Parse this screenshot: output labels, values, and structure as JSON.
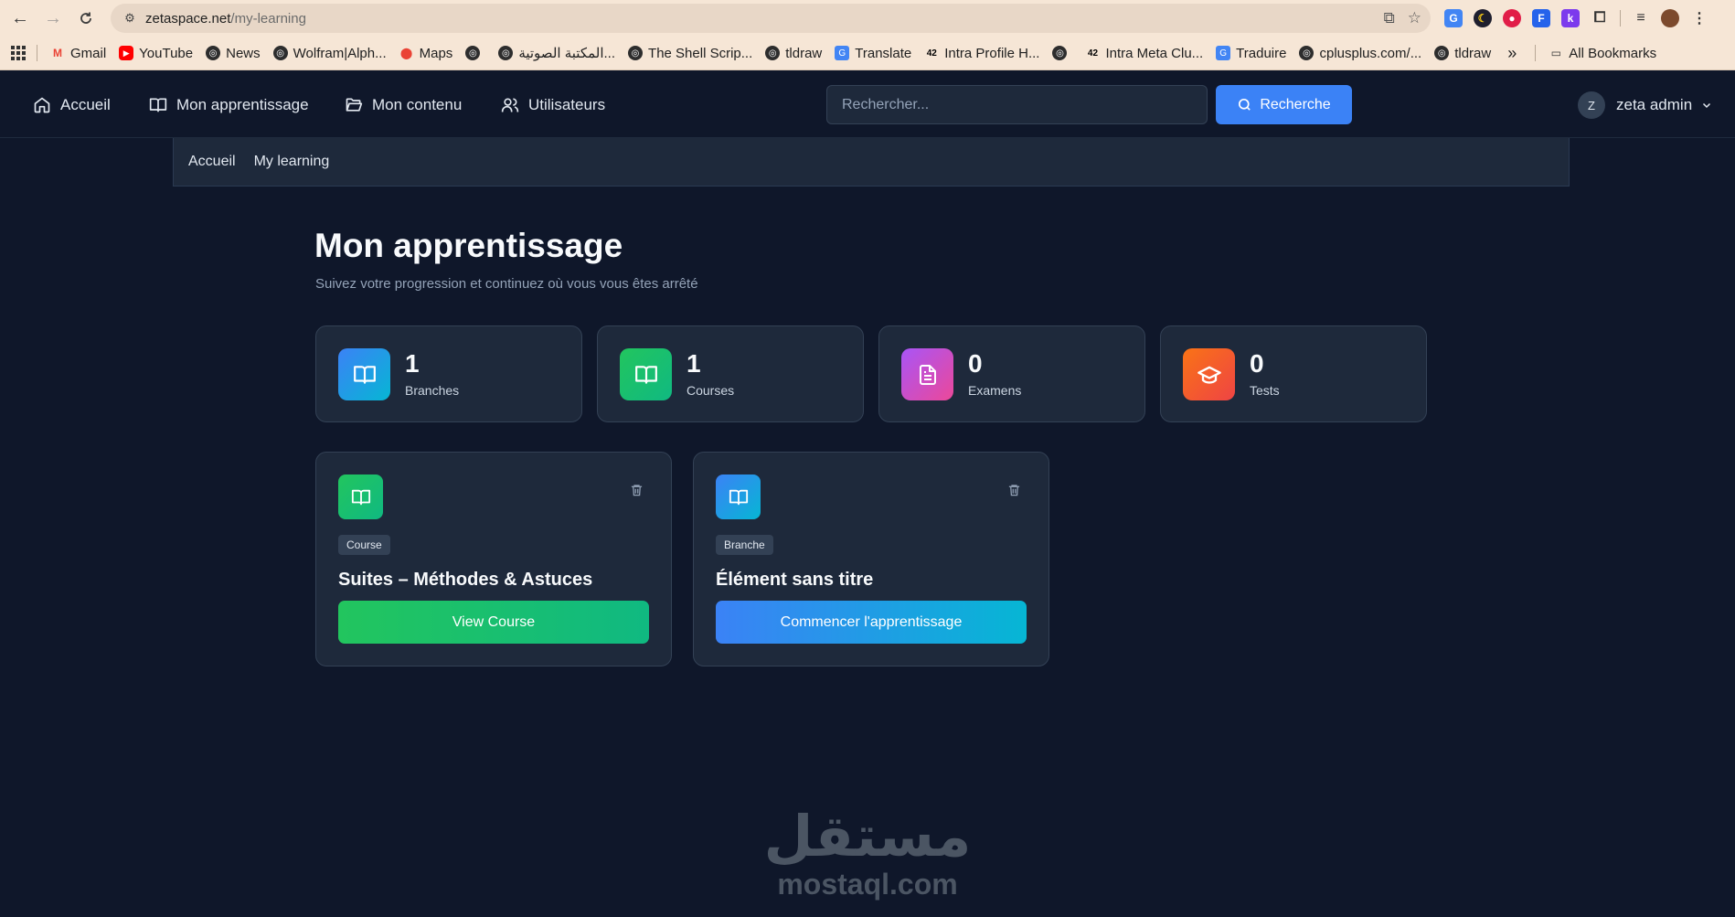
{
  "browser": {
    "url_host": "zetaspace.net",
    "url_path": "/my-learning",
    "bookmarks": [
      {
        "label": "Gmail",
        "icon": "gmail-icon"
      },
      {
        "label": "YouTube",
        "icon": "youtube-icon"
      },
      {
        "label": "News",
        "icon": "globe-icon"
      },
      {
        "label": "Wolfram|Alph...",
        "icon": "globe-icon"
      },
      {
        "label": "Maps",
        "icon": "maps-icon"
      },
      {
        "label": "",
        "icon": "globe-icon"
      },
      {
        "label": "المكتبة الصوتية...",
        "icon": "globe-icon"
      },
      {
        "label": "The Shell Scrip...",
        "icon": "globe-icon"
      },
      {
        "label": "tldraw",
        "icon": "globe-icon"
      },
      {
        "label": "Translate",
        "icon": "translate-icon"
      },
      {
        "label": "Intra Profile H...",
        "icon": "42-icon"
      },
      {
        "label": "",
        "icon": "globe-icon"
      },
      {
        "label": "Intra Meta Clu...",
        "icon": "42-icon"
      },
      {
        "label": "Traduire",
        "icon": "translate-icon"
      },
      {
        "label": "cplusplus.com/...",
        "icon": "globe-icon"
      },
      {
        "label": "tldraw",
        "icon": "globe-icon"
      }
    ],
    "more_label": "»",
    "all_bookmarks": "All Bookmarks"
  },
  "nav": {
    "home": "Accueil",
    "learning": "Mon apprentissage",
    "content": "Mon contenu",
    "users": "Utilisateurs",
    "search_placeholder": "Rechercher...",
    "search_button": "Recherche",
    "user_initial": "Z",
    "user_name": "zeta admin"
  },
  "breadcrumb": {
    "home": "Accueil",
    "current": "My learning"
  },
  "page": {
    "title": "Mon apprentissage",
    "subtitle": "Suivez votre progression et continuez où vous vous êtes arrêté"
  },
  "stats": [
    {
      "value": "1",
      "label": "Branches",
      "icon": "book-open-icon",
      "color_from": "#3b82f6",
      "color_to": "#06b6d4"
    },
    {
      "value": "1",
      "label": "Courses",
      "icon": "book-open-icon",
      "color_from": "#22c55e",
      "color_to": "#10b981"
    },
    {
      "value": "0",
      "label": "Examens",
      "icon": "file-text-icon",
      "color_from": "#a855f7",
      "color_to": "#ec4899"
    },
    {
      "value": "0",
      "label": "Tests",
      "icon": "graduation-cap-icon",
      "color_from": "#f97316",
      "color_to": "#ef4444"
    }
  ],
  "cards": [
    {
      "badge": "Course",
      "title": "Suites – Méthodes & Astuces",
      "button": "View Course",
      "color_from": "#22c55e",
      "color_to": "#10b981"
    },
    {
      "badge": "Branche",
      "title": "Élément sans titre",
      "button": "Commencer l'apprentissage",
      "color_from": "#3b82f6",
      "color_to": "#06b6d4"
    }
  ],
  "watermark": {
    "arabic": "مستقل",
    "latin": "mostaql.com"
  }
}
